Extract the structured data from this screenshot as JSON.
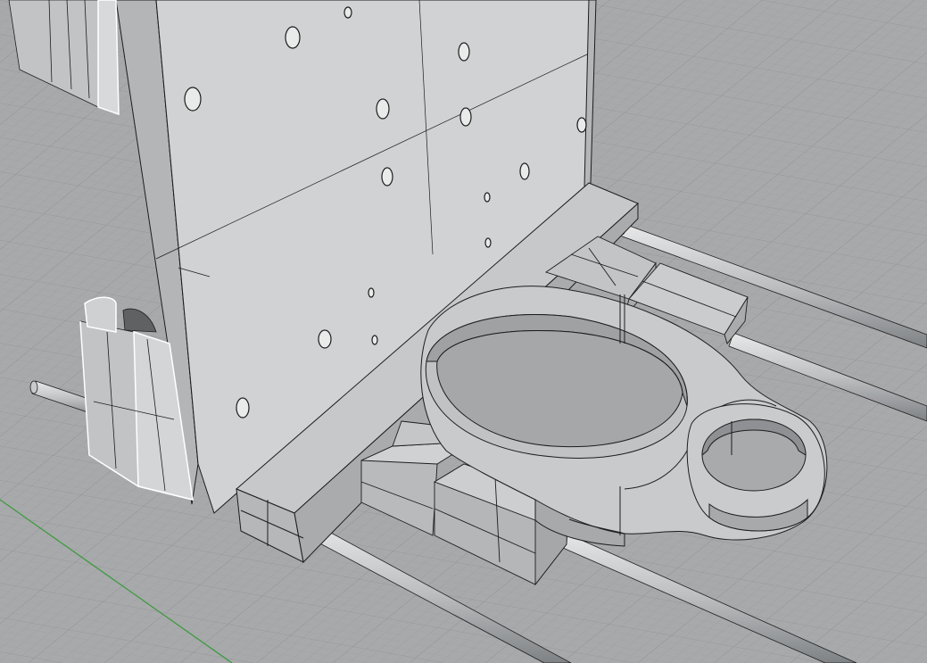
{
  "viewport": {
    "background_color": "#a7a9ab",
    "grid_minor_color": "#9a9d9f",
    "grid_major_color": "#8d9093",
    "axis_x_color": "#b85a55",
    "axis_y_color": "#3f9a3f",
    "display_mode": "shaded"
  },
  "scene": {
    "objects": [
      "back-plate",
      "base-plate",
      "linear-rod-left",
      "linear-rod-front",
      "linear-rod-right-upper",
      "linear-rod-right-lower",
      "bearing-block-left-top",
      "bearing-block-left-bottom",
      "clamp-ring-mount",
      "bearing-block-right-upper",
      "bearing-block-right-lower",
      "small-eye-ring"
    ],
    "edge_color": "#1d1d1d",
    "face_colors": {
      "light": "#d3d4d5",
      "mid": "#bebfc1",
      "dark": "#8e9093",
      "selected_edge": "#ffffff"
    }
  }
}
